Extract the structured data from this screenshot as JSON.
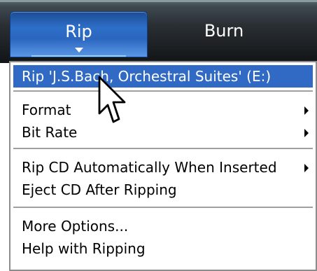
{
  "tabs": [
    {
      "label": "Rip",
      "active": true
    },
    {
      "label": "Burn",
      "active": false
    }
  ],
  "menu": {
    "items": [
      {
        "label": "Rip 'J.S.Bach, Orchestral Suites' (E:)",
        "selected": true,
        "submenu": false
      },
      {
        "label": "Format",
        "selected": false,
        "submenu": true
      },
      {
        "label": "Bit Rate",
        "selected": false,
        "submenu": true
      },
      {
        "label": "Rip CD Automatically When Inserted",
        "selected": false,
        "submenu": true
      },
      {
        "label": "Eject CD After Ripping",
        "selected": false,
        "submenu": false
      },
      {
        "label": "More Options...",
        "selected": false,
        "submenu": false
      },
      {
        "label": "Help with Ripping",
        "selected": false,
        "submenu": false
      }
    ]
  },
  "colors": {
    "highlight": "#316ac5",
    "tab_active": "#2d6fc9",
    "toolbar_dark": "#121417"
  },
  "icons": {
    "tab_caret": "chevron-down-icon",
    "submenu": "submenu-arrow-icon",
    "pointer": "mouse-pointer-icon"
  }
}
